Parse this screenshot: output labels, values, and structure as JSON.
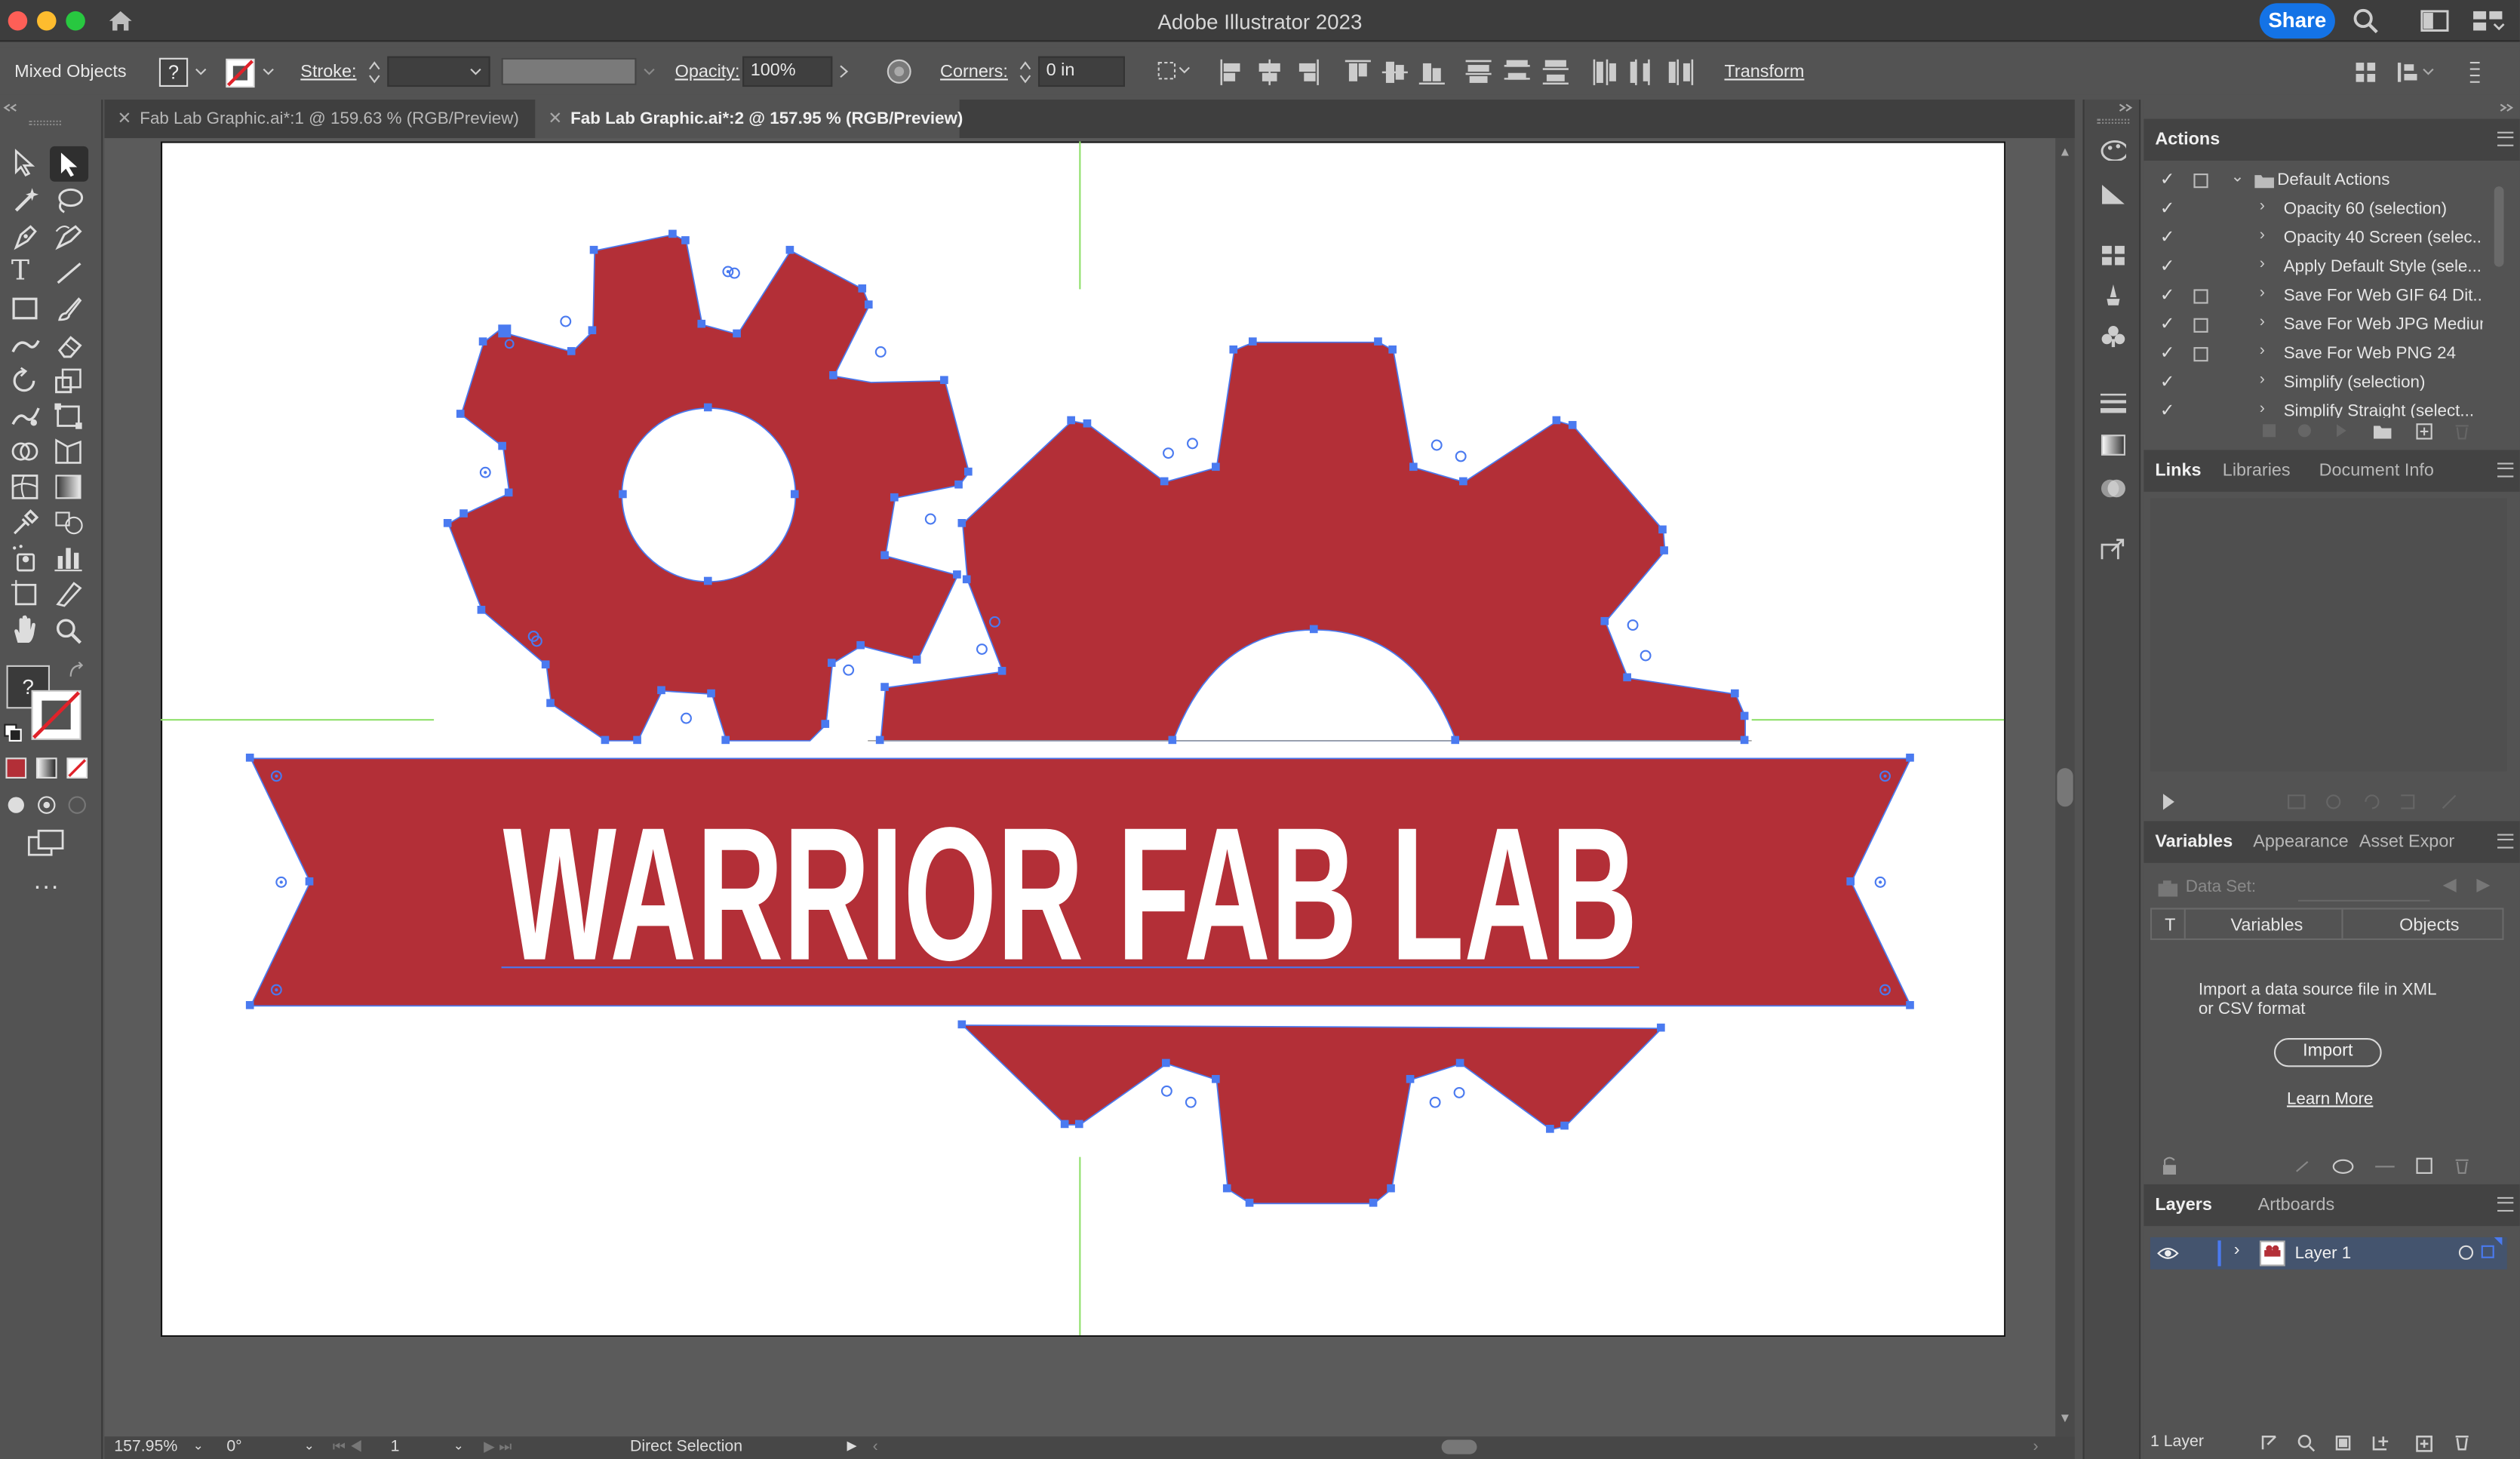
{
  "window": {
    "title": "Adobe Illustrator 2023",
    "share_label": "Share",
    "colors": {
      "close": "#fe5f57",
      "minimize": "#febc2e",
      "zoom": "#28c840"
    }
  },
  "control_bar": {
    "selection_type": "Mixed Objects",
    "fill_unknown": "?",
    "stroke_label": "Stroke:",
    "opacity_label": "Opacity:",
    "opacity_value": "100%",
    "corners_label": "Corners:",
    "corners_value": "0 in",
    "transform_label": "Transform"
  },
  "tabs": [
    {
      "label": "Fab Lab Graphic.ai*:1 @ 159.63 % (RGB/Preview)",
      "active": false
    },
    {
      "label": "Fab Lab Graphic.ai*:2 @ 157.95 % (RGB/Preview)",
      "active": true
    }
  ],
  "toolbar": {
    "fill_unknown": "?",
    "more_label": "..."
  },
  "artwork": {
    "title_text": "WARRIOR FAB LAB",
    "brand_color": "#b32f37",
    "selection_color": "#4a7af0",
    "guide_color": "#8fe06b"
  },
  "status_bar": {
    "zoom": "157.95%",
    "rotation": "0°",
    "artboard_number": "1",
    "tool": "Direct Selection"
  },
  "actions_panel": {
    "tab": "Actions",
    "set_name": "Default Actions",
    "items": [
      {
        "label": "Opacity 60 (selection)",
        "dialog": false
      },
      {
        "label": "Opacity 40 Screen (selec...",
        "dialog": false
      },
      {
        "label": "Apply Default Style (sele...",
        "dialog": false
      },
      {
        "label": "Save For Web GIF 64 Dit...",
        "dialog": true
      },
      {
        "label": "Save For Web JPG Medium",
        "dialog": true
      },
      {
        "label": "Save For Web PNG 24",
        "dialog": true
      },
      {
        "label": "Simplify (selection)",
        "dialog": false
      },
      {
        "label": "Simplify Straight (select...",
        "dialog": false
      }
    ]
  },
  "links_panel": {
    "tabs": [
      "Links",
      "Libraries",
      "Document Info"
    ]
  },
  "variables_panel": {
    "tabs": [
      "Variables",
      "Appearance",
      "Asset Expor"
    ],
    "data_set_label": "Data Set:",
    "col_type": "T",
    "col_variables": "Variables",
    "col_objects": "Objects",
    "import_message": "Import a data source file in XML or CSV format",
    "import_button": "Import",
    "learn_more": "Learn More"
  },
  "layers_panel": {
    "tabs": [
      "Layers",
      "Artboards"
    ],
    "layer_name": "Layer 1",
    "layer_count": "1 Layer"
  }
}
